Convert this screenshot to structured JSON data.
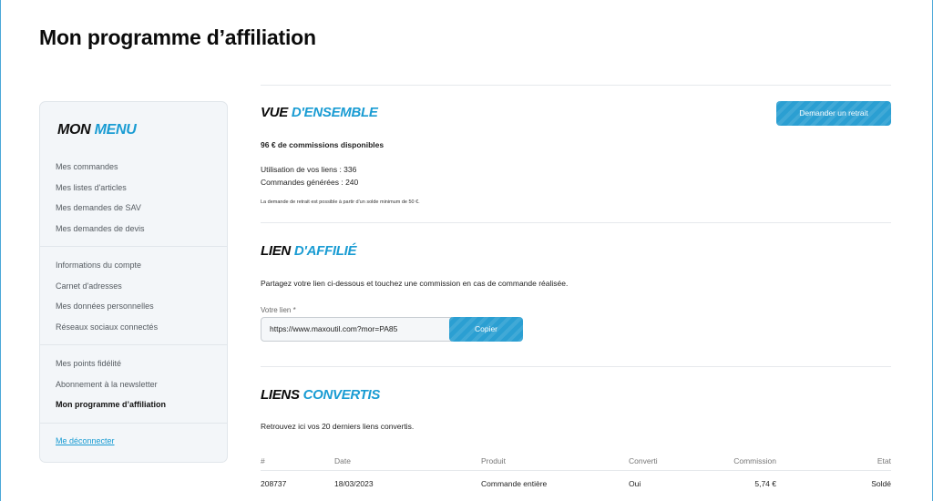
{
  "page": {
    "title": "Mon programme d’affiliation"
  },
  "sidebar": {
    "title_part1": "MON",
    "title_part2": "MENU",
    "group1": [
      "Mes commandes",
      "Mes listes d'articles",
      "Mes demandes de SAV",
      "Mes demandes de devis"
    ],
    "group2": [
      "Informations du compte",
      "Carnet d'adresses",
      "Mes données personnelles",
      "Réseaux sociaux connectés"
    ],
    "group3": [
      "Mes points fidélité",
      "Abonnement à la newsletter",
      "Mon programme d’affiliation"
    ],
    "logout": "Me déconnecter"
  },
  "overview": {
    "title_part1": "VUE",
    "title_part2": "D'ENSEMBLE",
    "withdraw_button": "Demander un retrait",
    "commissions": "96 € de commissions disponibles",
    "link_usage": "Utilisation de vos liens : 336",
    "orders": "Commandes générées : 240",
    "notice": "La demande de retrait est possible à partir d'un solde minimum de 50 €."
  },
  "affiliate": {
    "title_part1": "LIEN",
    "title_part2": "D'AFFILIÉ",
    "description": "Partagez votre lien ci-dessous et touchez une commission en cas de commande réalisée.",
    "input_label": "Votre lien *",
    "input_value": "https://www.maxoutil.com?mor=PA85",
    "copy_button": "Copier"
  },
  "converted": {
    "title_part1": "LIENS",
    "title_part2": "CONVERTIS",
    "description": "Retrouvez ici vos 20 derniers liens convertis.",
    "headers": [
      "#",
      "Date",
      "Produit",
      "Converti",
      "Commission",
      "Etat"
    ],
    "rows": [
      [
        "208737",
        "18/03/2023",
        "Commande entière",
        "Oui",
        "5,74 €",
        "Soldé"
      ]
    ]
  },
  "colors": {
    "accent": "#1a9cd3",
    "button": "#2b9fd2",
    "sidebar_bg": "#f3f6f9"
  }
}
